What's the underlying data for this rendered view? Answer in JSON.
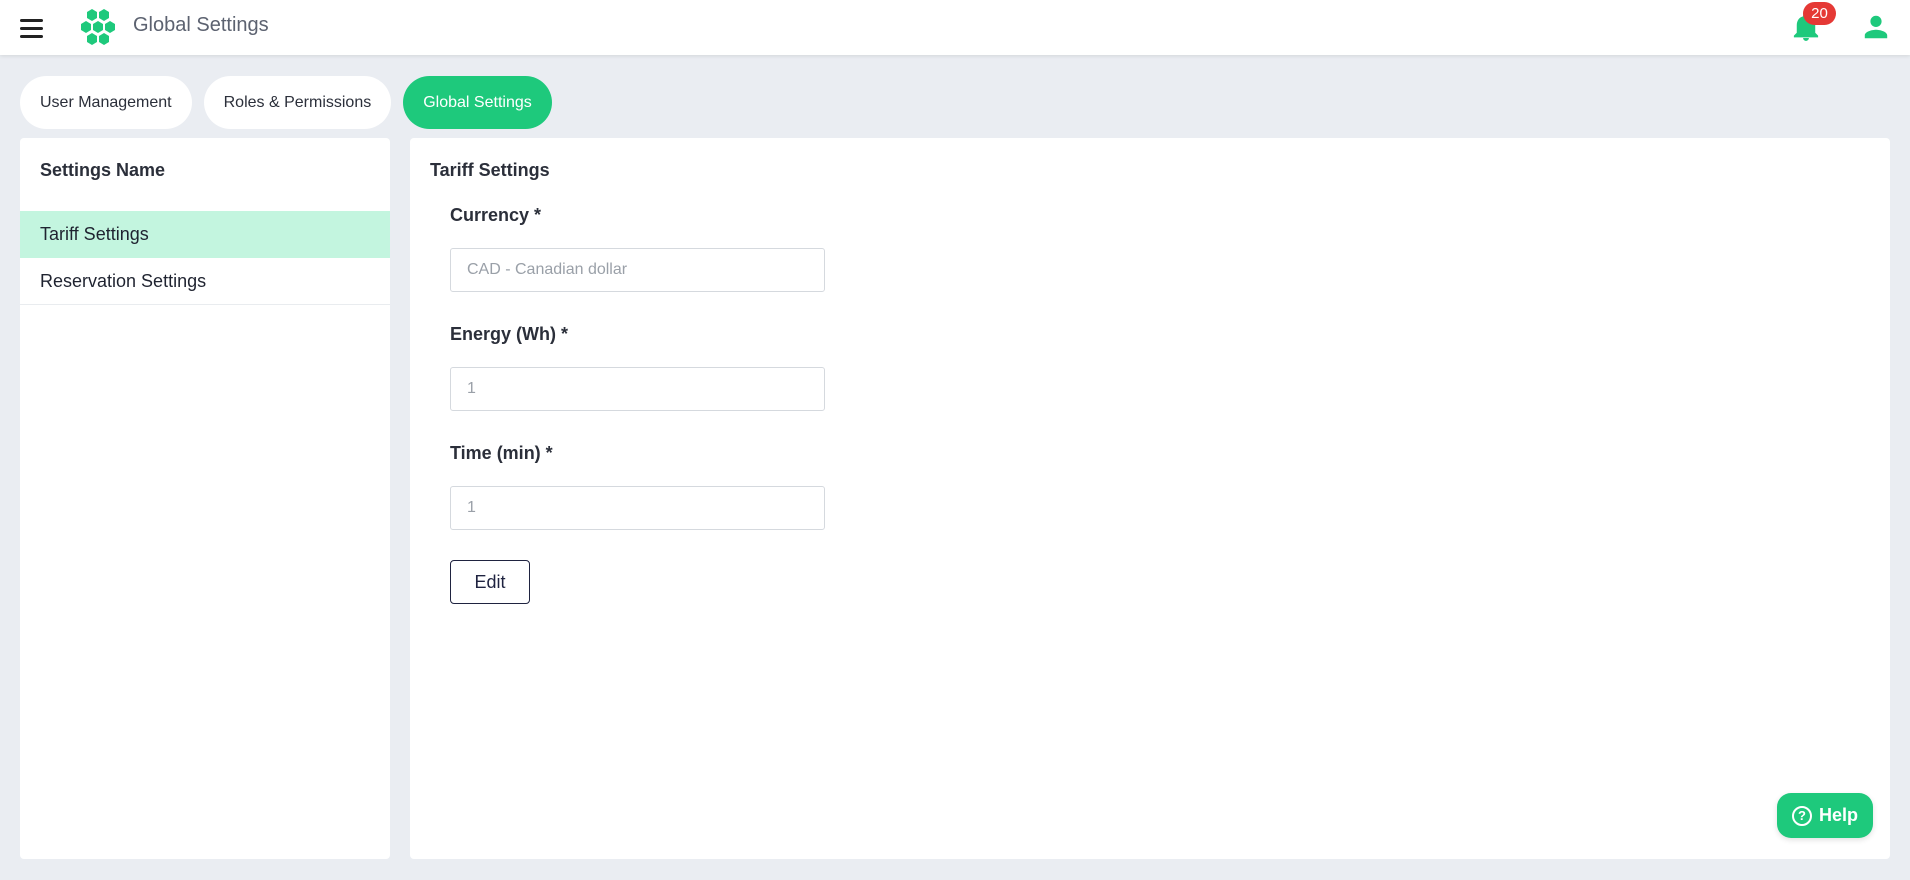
{
  "header": {
    "title": "Global Settings",
    "notification_count": "20",
    "icons": [
      "menu-icon",
      "hexagon-logo-icon",
      "bell-icon",
      "user-icon"
    ],
    "accent_color": "#1ec97c",
    "badge_color": "#e53935"
  },
  "tabs": [
    {
      "label": "User Management",
      "active": false
    },
    {
      "label": "Roles & Permissions",
      "active": false
    },
    {
      "label": "Global Settings",
      "active": true
    }
  ],
  "sidebar": {
    "title": "Settings Name",
    "items": [
      {
        "label": "Tariff Settings",
        "active": true
      },
      {
        "label": "Reservation Settings",
        "active": false
      }
    ],
    "active_color": "#c3f5df"
  },
  "main": {
    "title": "Tariff Settings",
    "fields": [
      {
        "label": "Currency *",
        "value": "CAD - Canadian dollar"
      },
      {
        "label": "Energy (Wh) *",
        "value": "1"
      },
      {
        "label": "Time (min) *",
        "value": "1"
      }
    ],
    "edit_label": "Edit"
  },
  "help": {
    "label": "Help",
    "icon_glyph": "?"
  }
}
